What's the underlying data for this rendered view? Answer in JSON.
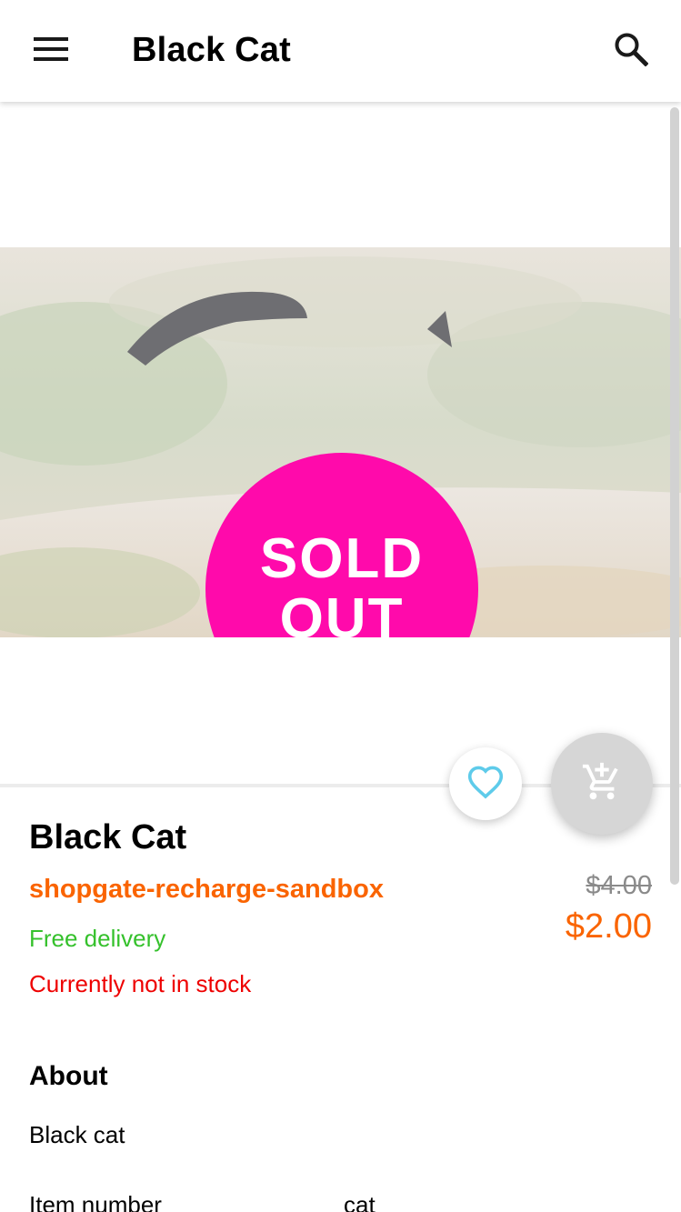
{
  "app_bar": {
    "title": "Black Cat",
    "menu_icon": "menu-icon",
    "search_icon": "search-icon"
  },
  "gallery": {
    "sold_out_line1": "SOLD",
    "sold_out_line2": "OUT",
    "sold_out_color": "#ff0aab"
  },
  "actions": {
    "favorite_icon": "heart-outline-icon",
    "add_to_cart_icon": "add-shopping-cart-icon",
    "favorite_color": "#5ecbea"
  },
  "product": {
    "name": "Black Cat",
    "manufacturer": "shopgate-recharge-sandbox",
    "shipping": "Free delivery",
    "availability": "Currently not in stock",
    "old_price": "$4.00",
    "price": "$2.00"
  },
  "colors": {
    "accent": "#fa6400",
    "shipping": "#35c12c",
    "availability": "#ee0000",
    "price": "#fa6400"
  },
  "about": {
    "heading": "About",
    "description": "Black cat"
  },
  "properties": [
    {
      "label": "Item number",
      "value": "cat"
    }
  ]
}
